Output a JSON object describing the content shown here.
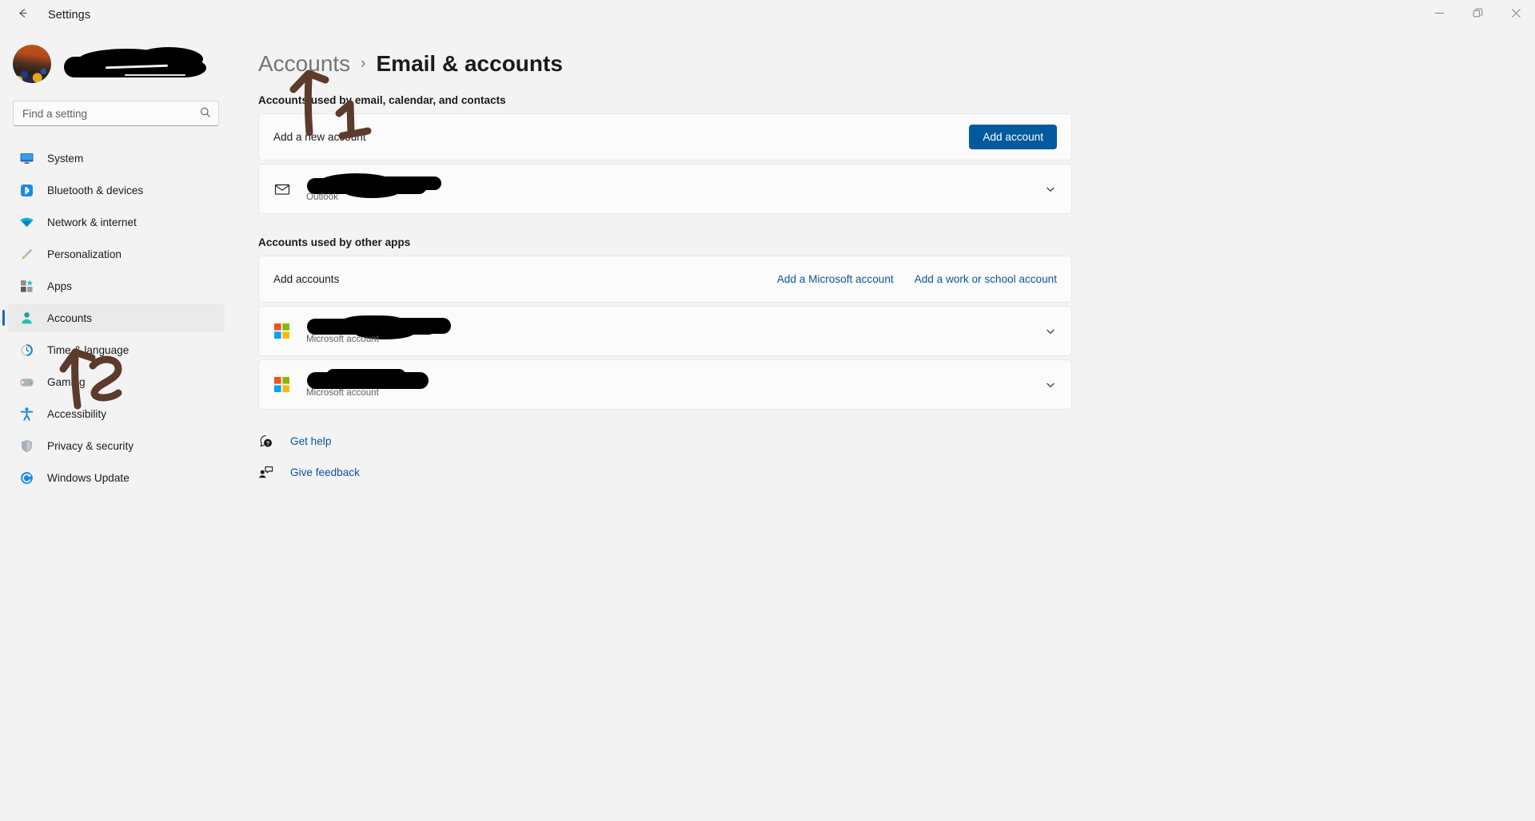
{
  "window": {
    "title": "Settings",
    "back_icon": "back-arrow-icon",
    "controls": {
      "minimize": "minimize-icon",
      "maximize": "restore-icon",
      "close": "close-icon"
    }
  },
  "sidebar": {
    "profile": {
      "name": "",
      "avatar": "user-avatar"
    },
    "search": {
      "placeholder": "Find a setting",
      "value": "",
      "icon": "search-icon"
    },
    "items": [
      {
        "label": "System",
        "icon": "monitor-icon",
        "selected": false
      },
      {
        "label": "Bluetooth & devices",
        "icon": "bluetooth-icon",
        "selected": false
      },
      {
        "label": "Network & internet",
        "icon": "wifi-icon",
        "selected": false
      },
      {
        "label": "Personalization",
        "icon": "paintbrush-icon",
        "selected": false
      },
      {
        "label": "Apps",
        "icon": "apps-icon",
        "selected": false
      },
      {
        "label": "Accounts",
        "icon": "person-icon",
        "selected": true
      },
      {
        "label": "Time & language",
        "icon": "clock-icon",
        "selected": false
      },
      {
        "label": "Gaming",
        "icon": "gamepad-icon",
        "selected": false
      },
      {
        "label": "Accessibility",
        "icon": "accessibility-icon",
        "selected": false
      },
      {
        "label": "Privacy & security",
        "icon": "shield-icon",
        "selected": false
      },
      {
        "label": "Windows Update",
        "icon": "update-icon",
        "selected": false
      }
    ]
  },
  "main": {
    "breadcrumb": {
      "parent": "Accounts",
      "separator": "›",
      "current": "Email & accounts"
    },
    "section_email": {
      "title": "Accounts used by email, calendar, and contacts",
      "add_row": {
        "label": "Add a new account",
        "button": "Add account"
      },
      "accounts": [
        {
          "name": "",
          "subtitle": "Outlook",
          "icon": "envelope-icon",
          "chevron": "chevron-down-icon"
        }
      ]
    },
    "section_other": {
      "title": "Accounts used by other apps",
      "add_row": {
        "label": "Add accounts",
        "link_microsoft": "Add a Microsoft account",
        "link_work": "Add a work or school account"
      },
      "accounts": [
        {
          "name": "",
          "subtitle": "Microsoft account",
          "icon": "microsoft-logo-icon",
          "chevron": "chevron-down-icon"
        },
        {
          "name": "",
          "subtitle": "Microsoft account",
          "icon": "microsoft-logo-icon",
          "chevron": "chevron-down-icon"
        }
      ]
    },
    "footer": [
      {
        "label": "Get help",
        "icon": "help-icon"
      },
      {
        "label": "Give feedback",
        "icon": "feedback-icon"
      }
    ]
  },
  "annotations": {
    "color": "#5c3b2b",
    "marks": [
      {
        "name": "arrow-to-breadcrumb",
        "kind": "arrow-up"
      },
      {
        "name": "step-number-1",
        "kind": "digit-1"
      },
      {
        "name": "arrow-to-accounts-nav",
        "kind": "arrow-up"
      },
      {
        "name": "step-number-2",
        "kind": "digit-2"
      }
    ]
  },
  "colors": {
    "page_background": "#f3f3f3",
    "card_background": "#fbfbfb",
    "accent": "#005a9e",
    "link": "#0a549c",
    "selection_indicator": "#0f6cbd",
    "annotation": "#5c3b2b"
  }
}
